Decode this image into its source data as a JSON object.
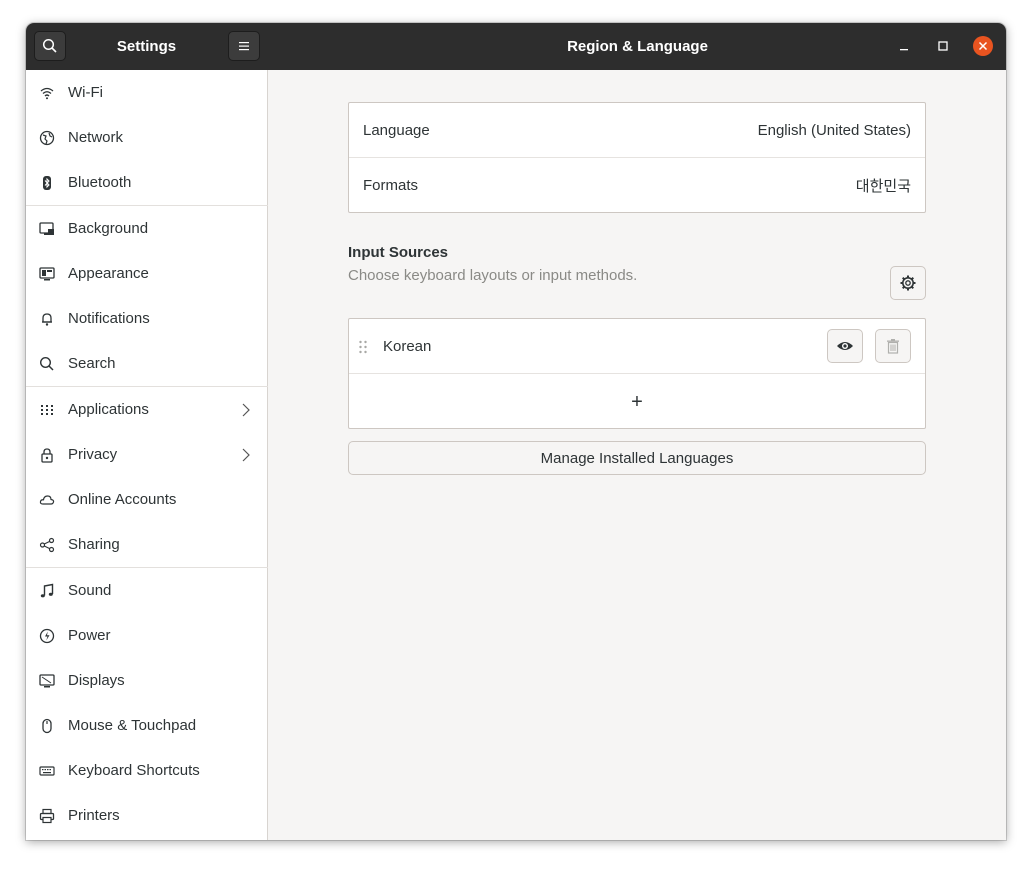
{
  "header": {
    "app_title": "Settings",
    "panel_title": "Region & Language"
  },
  "sidebar": {
    "items": [
      {
        "label": "Wi-Fi",
        "icon": "wifi-icon"
      },
      {
        "label": "Network",
        "icon": "network-globe-icon"
      },
      {
        "label": "Bluetooth",
        "icon": "bluetooth-icon"
      },
      {
        "label": "Background",
        "icon": "background-icon"
      },
      {
        "label": "Appearance",
        "icon": "appearance-icon"
      },
      {
        "label": "Notifications",
        "icon": "bell-icon"
      },
      {
        "label": "Search",
        "icon": "search-icon"
      },
      {
        "label": "Applications",
        "icon": "grid-icon"
      },
      {
        "label": "Privacy",
        "icon": "lock-icon"
      },
      {
        "label": "Online Accounts",
        "icon": "cloud-icon"
      },
      {
        "label": "Sharing",
        "icon": "share-icon"
      },
      {
        "label": "Sound",
        "icon": "music-note-icon"
      },
      {
        "label": "Power",
        "icon": "power-icon"
      },
      {
        "label": "Displays",
        "icon": "display-icon"
      },
      {
        "label": "Mouse & Touchpad",
        "icon": "mouse-icon"
      },
      {
        "label": "Keyboard Shortcuts",
        "icon": "keyboard-icon"
      },
      {
        "label": "Printers",
        "icon": "printer-icon"
      }
    ]
  },
  "language_box": {
    "language_label": "Language",
    "language_value": "English (United States)",
    "formats_label": "Formats",
    "formats_value": "대한민국"
  },
  "input_sources": {
    "title": "Input Sources",
    "subtitle": "Choose keyboard layouts or input methods.",
    "items": [
      {
        "label": "Korean"
      }
    ],
    "add_symbol": "+"
  },
  "manage_button": "Manage Installed Languages",
  "colors": {
    "headerbar": "#2d2d2d",
    "close_button": "#e95420",
    "window_bg": "#f6f5f4",
    "text": "#2e3436"
  }
}
